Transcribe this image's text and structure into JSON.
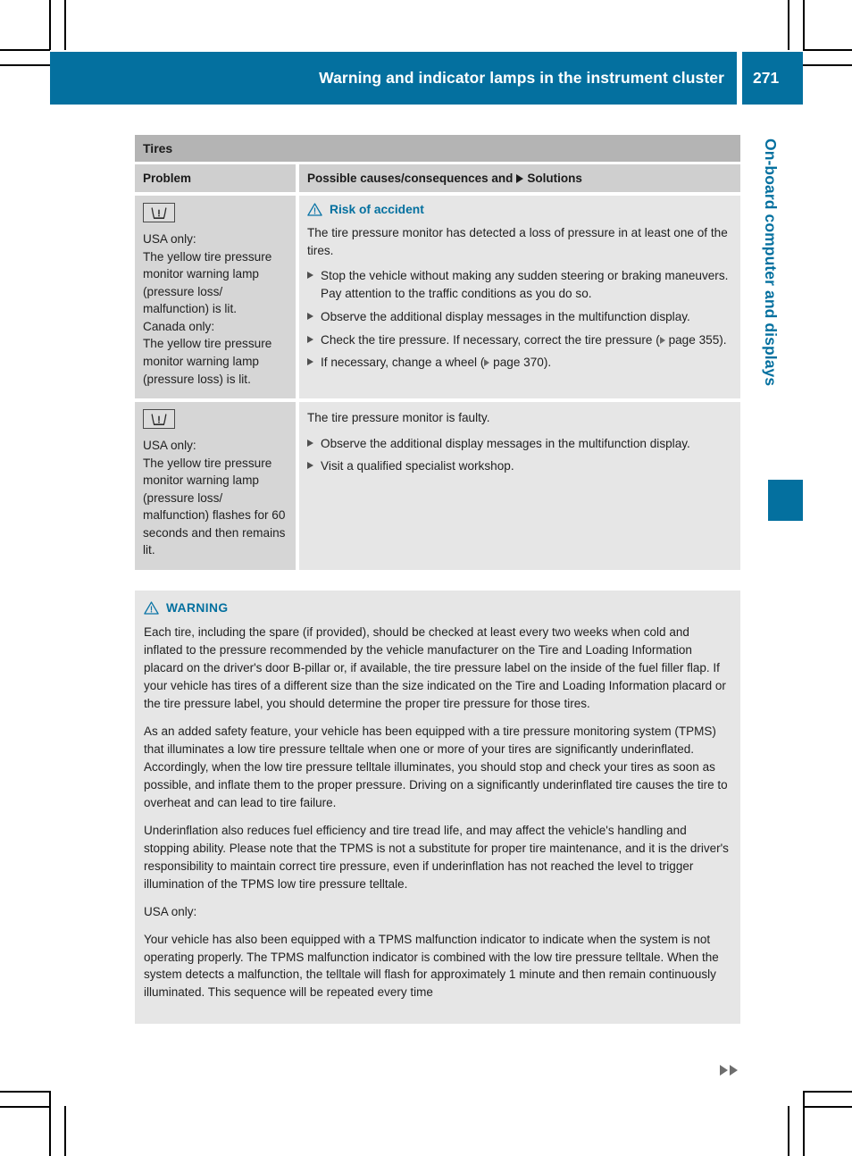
{
  "header": {
    "title": "Warning and indicator lamps in the instrument cluster",
    "page_number": "271"
  },
  "chapter_tab": {
    "label": "On-board computer and displays"
  },
  "table": {
    "caption": "Tires",
    "columns": {
      "problem": "Problem",
      "solutions_prefix": "Possible causes/consequences and",
      "solutions_suffix": "Solutions"
    },
    "rows": [
      {
        "problem": {
          "icon": "tpms-telltale-icon",
          "lines": [
            "USA only:",
            "The yellow tire pressure monitor warning lamp (pressure loss/ malfunction) is lit.",
            "Canada only:",
            "The yellow tire pressure monitor warning lamp (pressure loss) is lit."
          ]
        },
        "warning_heading": "Risk of accident",
        "cause": "The tire pressure monitor has detected a loss of pressure in at least one of the tires.",
        "steps": [
          "Stop the vehicle without making any sudden steering or braking maneuvers. Pay attention to the traffic conditions as you do so.",
          "Observe the additional display messages in the multifunction display.",
          "Check the tire pressure. If necessary, correct the tire pressure",
          "If necessary, change a wheel"
        ],
        "step_refs": [
          "",
          "",
          "page 355",
          "page 370"
        ]
      },
      {
        "problem": {
          "icon": "tpms-telltale-icon",
          "lines": [
            "USA only:",
            "The yellow tire pressure monitor warning lamp (pressure loss/ malfunction) flashes for 60 seconds and then remains lit."
          ]
        },
        "warning_heading": "",
        "cause": "The tire pressure monitor is faulty.",
        "steps": [
          "Observe the additional display messages in the multifunction display.",
          "Visit a qualified specialist workshop."
        ],
        "step_refs": [
          "",
          ""
        ]
      }
    ]
  },
  "warning_box": {
    "heading": "WARNING",
    "paragraphs": [
      "Each tire, including the spare (if provided), should be checked at least every two weeks when cold and inflated to the pressure recommended by the vehicle manufacturer on the Tire and Loading Information placard on the driver's door B-pillar or, if available, the tire pressure label on the inside of the fuel filler flap. If your vehicle has tires of a different size than the size indicated on the Tire and Loading Information placard or the tire pressure label, you should determine the proper tire pressure for those tires.",
      "As an added safety feature, your vehicle has been equipped with a tire pressure monitoring system (TPMS) that illuminates a low tire pressure telltale when one or more of your tires are significantly underinflated. Accordingly, when the low tire pressure telltale illuminates, you should stop and check your tires as soon as possible, and inflate them to the proper pressure. Driving on a significantly underinflated tire causes the tire to overheat and can lead to tire failure.",
      "Underinflation also reduces fuel efficiency and tire tread life, and may affect the vehicle's handling and stopping ability. Please note that the TPMS is not a substitute for proper tire maintenance, and it is the driver's responsibility to maintain correct tire pressure, even if underinflation has not reached the level to trigger illumination of the TPMS low tire pressure telltale.",
      "USA only:",
      "Your vehicle has also been equipped with a TPMS malfunction indicator to indicate when the system is not operating properly. The TPMS malfunction indicator is combined with the low tire pressure telltale. When the system detects a malfunction, the telltale will flash for approximately 1 minute and then remain continuously illuminated. This sequence will be repeated every time"
    ]
  },
  "colors": {
    "brand_blue": "#04709f",
    "caption_gray": "#b4b4b4",
    "header_row_gray": "#cfcfcf",
    "left_cell_gray": "#d6d6d6",
    "right_cell_gray": "#e6e6e6"
  },
  "footer": {
    "continuation_marker": "continuation-arrows"
  }
}
